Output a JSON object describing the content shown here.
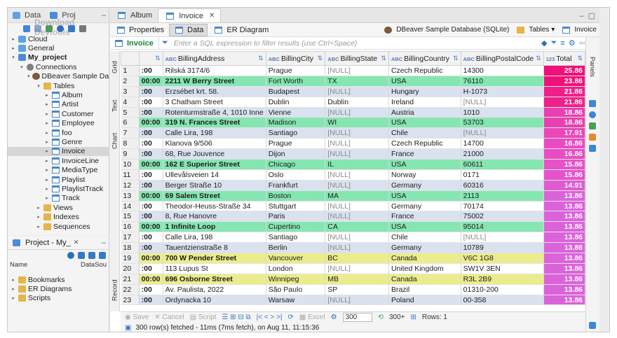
{
  "nav": {
    "tabs": [
      "Data",
      "Proj"
    ],
    "watermark": "Download Devtools",
    "tree": [
      {
        "label": "Cloud",
        "level": 0,
        "icon": "db",
        "tw": "▸",
        "bold": false
      },
      {
        "label": "General",
        "level": 0,
        "icon": "db",
        "tw": "▸",
        "bold": false
      },
      {
        "label": "My_project",
        "level": 0,
        "icon": "proj",
        "tw": "▾",
        "bold": true
      },
      {
        "label": "Connections",
        "level": 1,
        "icon": "conn",
        "tw": "▾",
        "bold": false
      },
      {
        "label": "DBeaver Sample Da",
        "level": 2,
        "icon": "beaver",
        "tw": "▾",
        "bold": false
      },
      {
        "label": "Tables",
        "level": 3,
        "icon": "folder",
        "tw": "▾",
        "bold": false
      },
      {
        "label": "Album",
        "level": 4,
        "icon": "table",
        "tw": "▸",
        "bold": false
      },
      {
        "label": "Artist",
        "level": 4,
        "icon": "table",
        "tw": "▸",
        "bold": false
      },
      {
        "label": "Customer",
        "level": 4,
        "icon": "table",
        "tw": "▸",
        "bold": false
      },
      {
        "label": "Employee",
        "level": 4,
        "icon": "table",
        "tw": "▸",
        "bold": false
      },
      {
        "label": "foo",
        "level": 4,
        "icon": "table",
        "tw": "▸",
        "bold": false
      },
      {
        "label": "Genre",
        "level": 4,
        "icon": "table",
        "tw": "▸",
        "bold": false
      },
      {
        "label": "Invoice",
        "level": 4,
        "icon": "table",
        "tw": "▸",
        "bold": false,
        "selected": true
      },
      {
        "label": "InvoiceLine",
        "level": 4,
        "icon": "table",
        "tw": "▸",
        "bold": false
      },
      {
        "label": "MediaType",
        "level": 4,
        "icon": "table",
        "tw": "▸",
        "bold": false
      },
      {
        "label": "Playlist",
        "level": 4,
        "icon": "table",
        "tw": "▸",
        "bold": false
      },
      {
        "label": "PlaylistTrack",
        "level": 4,
        "icon": "table",
        "tw": "▸",
        "bold": false
      },
      {
        "label": "Track",
        "level": 4,
        "icon": "table",
        "tw": "▸",
        "bold": false
      },
      {
        "label": "Views",
        "level": 3,
        "icon": "folder",
        "tw": "▸",
        "bold": false
      },
      {
        "label": "Indexes",
        "level": 3,
        "icon": "folder",
        "tw": "▸",
        "bold": false
      },
      {
        "label": "Sequences",
        "level": 3,
        "icon": "folder",
        "tw": "▸",
        "bold": false
      }
    ]
  },
  "project": {
    "title": "Project - My_",
    "col_name": "Name",
    "col_source": "DataSou",
    "items": [
      "Bookmarks",
      "ER Diagrams",
      "Scripts"
    ]
  },
  "editor": {
    "tabs": [
      "Album",
      "Invoice"
    ],
    "subtabs": [
      "Properties",
      "Data",
      "ER Diagram"
    ],
    "connection": "DBeaver Sample Database (SQLite)",
    "tables_label": "Tables",
    "object_label": "Invoice",
    "filter_tab": "Invoice",
    "filter_placeholder": "Enter a SQL expression to filter results (use Ctrl+Space)"
  },
  "side_tabs": [
    "Grid",
    "Text",
    "Chart",
    "Record"
  ],
  "right_panel": "Panels",
  "grid": {
    "columns": [
      "BillingAddress",
      "BillingCity",
      "BillingState",
      "BillingCountry",
      "BillingPostalCode",
      "Total"
    ],
    "total_type": "123",
    "rows": [
      {
        "n": "1",
        "t": ":00",
        "addr": "Rilská 3174/6",
        "city": "Prague",
        "state": "[NULL]",
        "country": "Czech Republic",
        "postal": "14300",
        "total": "25.86",
        "kind": "white",
        "tcolor": "#f0107a"
      },
      {
        "n": "2",
        "t": "00:00",
        "addr": "2211 W Berry Street",
        "city": "Fort Worth",
        "state": "TX",
        "country": "USA",
        "postal": "76110",
        "total": "23.86",
        "kind": "usa",
        "tcolor": "#f0107a"
      },
      {
        "n": "3",
        "t": ":00",
        "addr": "Erzsébet krt. 58.",
        "city": "Budapest",
        "state": "[NULL]",
        "country": "Hungary",
        "postal": "H-1073",
        "total": "21.86",
        "kind": "other",
        "tcolor": "#f0208b"
      },
      {
        "n": "4",
        "t": ":00",
        "addr": "3 Chatham Street",
        "city": "Dublin",
        "state": "Dublin",
        "country": "Ireland",
        "postal": "[NULL]",
        "total": "21.86",
        "kind": "white",
        "tcolor": "#f0208b"
      },
      {
        "n": "5",
        "t": ":00",
        "addr": "Rotenturmstraße 4, 1010 Inne",
        "city": "Vienne",
        "state": "[NULL]",
        "country": "Austria",
        "postal": "1010",
        "total": "18.86",
        "kind": "other",
        "tcolor": "#ea3fae"
      },
      {
        "n": "6",
        "t": "00:00",
        "addr": "319 N. Frances Street",
        "city": "Madison",
        "state": "WI",
        "country": "USA",
        "postal": "53703",
        "total": "18.86",
        "kind": "usa",
        "tcolor": "#ea3fae"
      },
      {
        "n": "7",
        "t": ":00",
        "addr": "Calle Lira, 198",
        "city": "Santiago",
        "state": "[NULL]",
        "country": "Chile",
        "postal": "[NULL]",
        "total": "17.91",
        "kind": "other",
        "tcolor": "#ea48b8"
      },
      {
        "n": "8",
        "t": ":00",
        "addr": "Klanova 9/506",
        "city": "Prague",
        "state": "[NULL]",
        "country": "Czech Republic",
        "postal": "14700",
        "total": "16.86",
        "kind": "white",
        "tcolor": "#e94cc2"
      },
      {
        "n": "9",
        "t": ":00",
        "addr": "68, Rue Jouvence",
        "city": "Dijon",
        "state": "[NULL]",
        "country": "France",
        "postal": "21000",
        "total": "16.86",
        "kind": "other",
        "tcolor": "#e94cc2"
      },
      {
        "n": "10",
        "t": "00:00",
        "addr": "162 E Superior Street",
        "city": "Chicago",
        "state": "IL",
        "country": "USA",
        "postal": "60611",
        "total": "15.86",
        "kind": "usa",
        "tcolor": "#e552c9"
      },
      {
        "n": "11",
        "t": ":00",
        "addr": "Ullevålsveien 14",
        "city": "Oslo",
        "state": "[NULL]",
        "country": "Norway",
        "postal": "0171",
        "total": "15.86",
        "kind": "white",
        "tcolor": "#e552c9"
      },
      {
        "n": "12",
        "t": ":00",
        "addr": "Berger Straße 10",
        "city": "Frankfurt",
        "state": "[NULL]",
        "country": "Germany",
        "postal": "60316",
        "total": "14.91",
        "kind": "other",
        "tcolor": "#e05ad2"
      },
      {
        "n": "13",
        "t": "00:00",
        "addr": "69 Salem Street",
        "city": "Boston",
        "state": "MA",
        "country": "USA",
        "postal": "2113",
        "total": "13.86",
        "kind": "usa",
        "tcolor": "#dc62dc"
      },
      {
        "n": "14",
        "t": ":00",
        "addr": "Theodor-Heuss-Straße 34",
        "city": "Stuttgart",
        "state": "[NULL]",
        "country": "Germany",
        "postal": "70174",
        "total": "13.86",
        "kind": "white",
        "tcolor": "#dc62dc"
      },
      {
        "n": "15",
        "t": ":00",
        "addr": "8, Rue Hanovre",
        "city": "Paris",
        "state": "[NULL]",
        "country": "France",
        "postal": "75002",
        "total": "13.86",
        "kind": "other",
        "tcolor": "#dc62dc"
      },
      {
        "n": "16",
        "t": "00:00",
        "addr": "1 Infinite Loop",
        "city": "Cupertino",
        "state": "CA",
        "country": "USA",
        "postal": "95014",
        "total": "13.86",
        "kind": "usa",
        "tcolor": "#dc62dc"
      },
      {
        "n": "17",
        "t": ":00",
        "addr": "Calle Lira, 198",
        "city": "Santiago",
        "state": "[NULL]",
        "country": "Chile",
        "postal": "[NULL]",
        "total": "13.86",
        "kind": "white",
        "tcolor": "#dc62dc"
      },
      {
        "n": "18",
        "t": ":00",
        "addr": "Tauentzienstraße 8",
        "city": "Berlin",
        "state": "[NULL]",
        "country": "Germany",
        "postal": "10789",
        "total": "13.86",
        "kind": "other",
        "tcolor": "#dc62dc"
      },
      {
        "n": "19",
        "t": "00:00",
        "addr": "700 W Pender Street",
        "city": "Vancouver",
        "state": "BC",
        "country": "Canada",
        "postal": "V6C 1G8",
        "total": "13.86",
        "kind": "canada",
        "tcolor": "#dc62dc"
      },
      {
        "n": "20",
        "t": ":00",
        "addr": "113 Lupus St",
        "city": "London",
        "state": "[NULL]",
        "country": "United Kingdom",
        "postal": "SW1V 3EN",
        "total": "13.86",
        "kind": "white",
        "tcolor": "#dc62dc"
      },
      {
        "n": "21",
        "t": "00:00",
        "addr": "696 Osborne Street",
        "city": "Winnipeg",
        "state": "MB",
        "country": "Canada",
        "postal": "R3L 2B9",
        "total": "13.86",
        "kind": "canada",
        "tcolor": "#dc62dc"
      },
      {
        "n": "22",
        "t": ":00",
        "addr": "Av. Paulista, 2022",
        "city": "São Paulo",
        "state": "SP",
        "country": "Brazil",
        "postal": "01310-200",
        "total": "13.86",
        "kind": "white",
        "tcolor": "#dc62dc"
      },
      {
        "n": "23",
        "t": ":00",
        "addr": "Ordynacka 10",
        "city": "Warsaw",
        "state": "[NULL]",
        "country": "Poland",
        "postal": "00-358",
        "total": "13.86",
        "kind": "other",
        "tcolor": "#dc62dc"
      }
    ]
  },
  "bottom": {
    "save": "Save",
    "cancel": "Cancel",
    "script": "Script",
    "excel": "Excel",
    "fetch_size": "300",
    "fetch_more": "300+",
    "rows": "Rows: 1"
  },
  "status": "300 row(s) fetched - 11ms (7ms fetch), on Aug 11, 11:15:36"
}
